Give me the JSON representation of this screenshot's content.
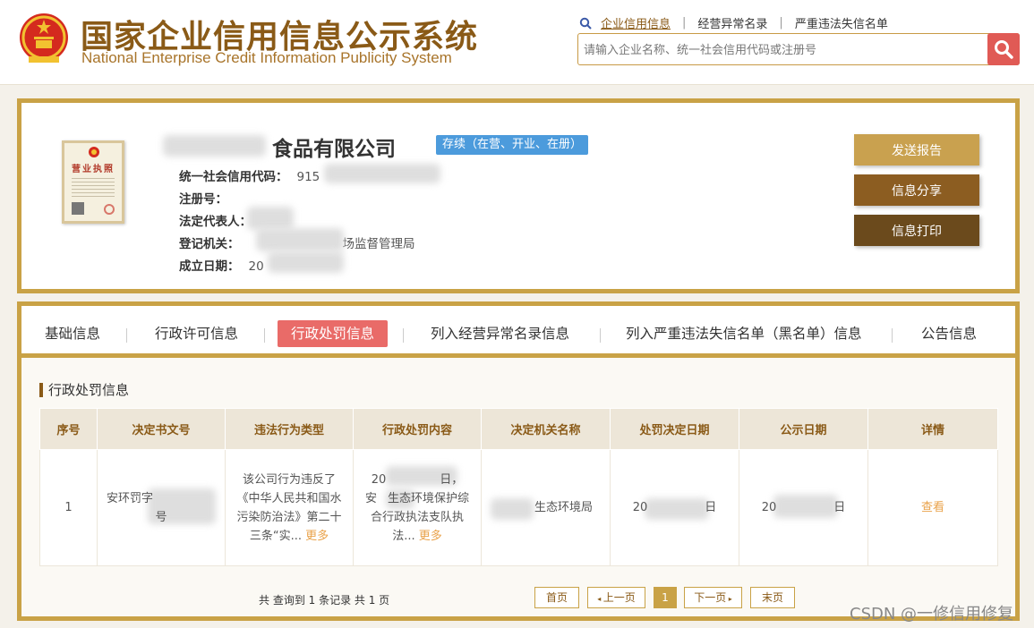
{
  "header": {
    "title_cn": "国家企业信用信息公示系统",
    "title_en": "National Enterprise Credit Information Publicity System",
    "nav": [
      "企业信用信息",
      "经营异常名录",
      "严重违法失信名单"
    ],
    "nav_separator": "|",
    "search_placeholder": "请输入企业名称、统一社会信用代码或注册号",
    "search_icon": "search-icon"
  },
  "company": {
    "name": "食品有限公司",
    "status": "存续（在营、开业、在册）",
    "license_label": "营业执照",
    "fields": {
      "credit_code_label": "统一社会信用代码：",
      "credit_code_value": "915",
      "reg_no_label": "注册号：",
      "legal_rep_label": "法定代表人：",
      "authority_label": "登记机关：",
      "authority_value": "场监督管理局",
      "established_label": "成立日期：",
      "established_value": "20"
    },
    "actions": {
      "send": "发送报告",
      "share": "信息分享",
      "print": "信息打印"
    }
  },
  "tabs": [
    "基础信息",
    "行政许可信息",
    "行政处罚信息",
    "列入经营异常名录信息",
    "列入严重违法失信名单（黑名单）信息",
    "公告信息"
  ],
  "section_title": "行政处罚信息",
  "table": {
    "headers": [
      "序号",
      "决定书文号",
      "违法行为类型",
      "行政处罚内容",
      "决定机关名称",
      "处罚决定日期",
      "公示日期",
      "详情"
    ],
    "row": {
      "index": "1",
      "doc_no_a": "安环罚字",
      "doc_no_b": "号",
      "violation": "该公司行为违反了《中华人民共和国水污染防治法》第二十三条“实...",
      "content_a": "20",
      "content_b": "日，",
      "content_c": "安",
      "content_d": "生态环境保护综合行政执法支队执法...",
      "authority": "生态环境局",
      "decision_date_a": "20",
      "decision_date_b": "日",
      "publish_date_a": "20",
      "publish_date_b": "日",
      "more": "更多",
      "view": "查看"
    }
  },
  "pagination": {
    "summary": "共 查询到 1 条记录 共 1 页",
    "first": "首页",
    "prev": "上一页",
    "current": "1",
    "next": "下一页",
    "last": "末页"
  },
  "watermark": "CSDN @一修信用修复",
  "colors": {
    "brand": "#8a5a17",
    "gold": "#c9a246",
    "active_tab": "#e96b68",
    "status_blue": "#4c9bdc",
    "search_red": "#e05a55",
    "link_orange": "#e9a24a"
  }
}
